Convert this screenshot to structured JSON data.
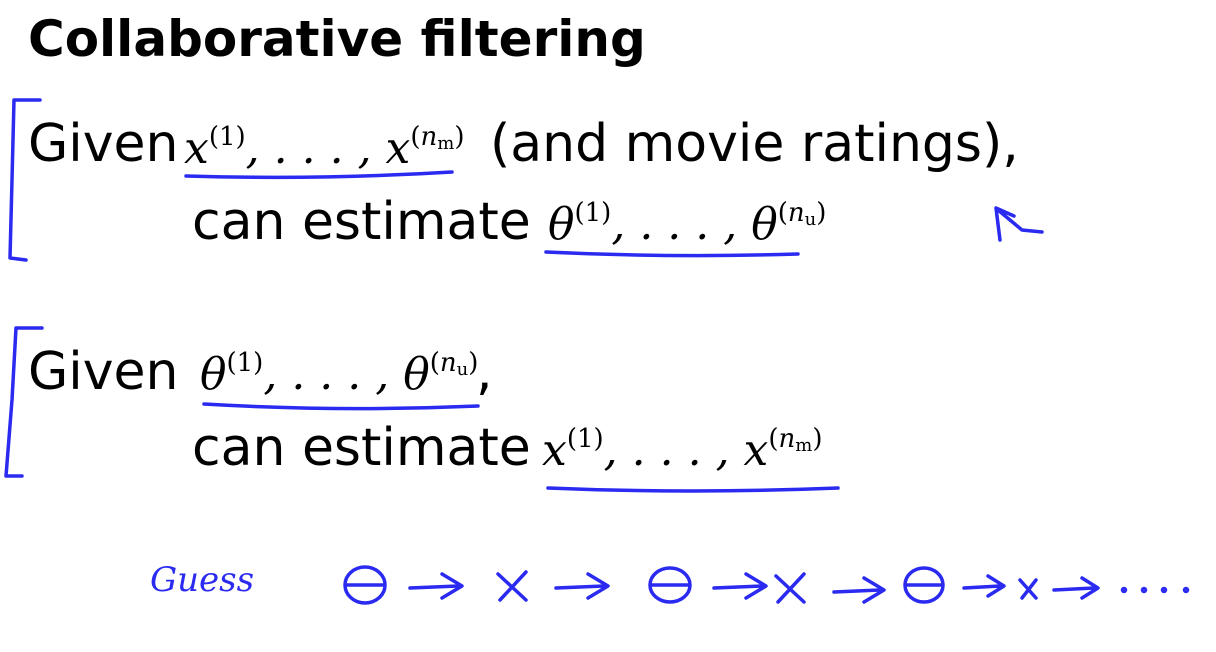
{
  "title": "Collaborative filtering",
  "block1": {
    "given": "Given",
    "given_math_base": "x",
    "given_math_sup1": "(1)",
    "given_math_mid": ", . . . , ",
    "given_math_base2": "x",
    "given_math_sup2_var": "n",
    "given_math_sup2_sub": "m",
    "suffix": "(and movie ratings),",
    "estimate": "can estimate",
    "est_math_base": "θ",
    "est_math_sup1": "(1)",
    "est_math_mid": ", . . . , ",
    "est_math_base2": "θ",
    "est_math_sup2_var": "n",
    "est_math_sup2_sub": "u"
  },
  "block2": {
    "given": "Given",
    "given_math_base": "θ",
    "given_math_sup1": "(1)",
    "given_math_mid": ", . . . , ",
    "given_math_base2": "θ",
    "given_math_sup2_var": "n",
    "given_math_sup2_sub": "u",
    "comma": ",",
    "estimate": "can estimate",
    "est_math_base": "x",
    "est_math_sup1": "(1)",
    "est_math_mid": ", . . . , ",
    "est_math_base2": "x",
    "est_math_sup2_var": "n",
    "est_math_sup2_sub": "m"
  },
  "annotation": {
    "guess_label": "Guess",
    "ink_color": "#2a2af0"
  }
}
